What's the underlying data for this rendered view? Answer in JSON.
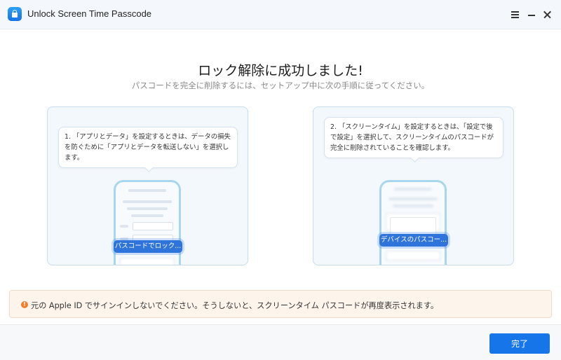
{
  "window": {
    "title": "Unlock Screen Time Passcode",
    "icon": "lock-icon"
  },
  "controls": {
    "menu": "menu-icon",
    "minimize": "minimize-icon",
    "close": "close-icon"
  },
  "heading": "ロック解除に成功しました!",
  "subheading": "パスコードを完全に削除するには、セットアップ中に次の手順に従ってください。",
  "steps": [
    {
      "text": "1. 「アプリとデータ」を設定するときは、データの損失を防ぐために「アプリとデータを転送しない」を選択します。",
      "highlight": "パスコードでロック..."
    },
    {
      "text": "2. 「スクリーンタイム」を設定するときは、「設定で後で設定」を選択して、スクリーンタイムのパスコードが完全に削除されていることを確認します。",
      "highlight": "デバイスのパスコー..."
    }
  ],
  "warning": {
    "icon": "exclamation-icon",
    "text": "元の Apple ID でサインインしないでください。そうしないと、スクリーンタイム パスコードが再度表示されます。"
  },
  "footer": {
    "done_label": "完了"
  },
  "colors": {
    "accent": "#1675e8",
    "warning": "#f17f2d",
    "card_border": "#c7dcef"
  }
}
